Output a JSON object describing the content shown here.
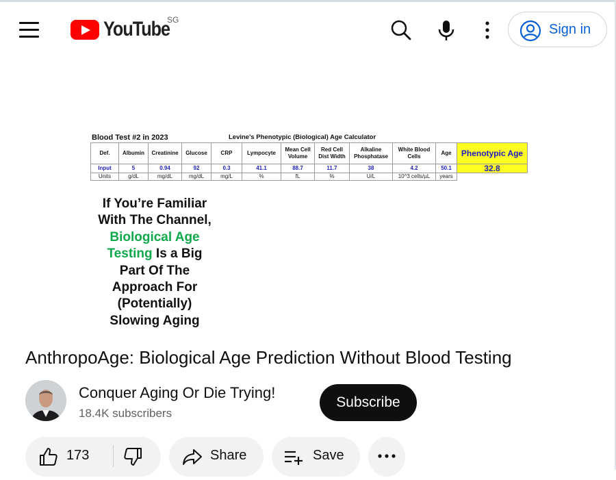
{
  "header": {
    "logo_text": "YouTube",
    "country_code": "SG",
    "sign_in_label": "Sign in",
    "icons": [
      "menu-icon",
      "search-icon",
      "mic-icon",
      "more-vert-icon",
      "account-circle-icon"
    ]
  },
  "thumbnail": {
    "blood_test_title": "Blood Test #2 in 2023",
    "calculator_title": "Levine's Phenotypic (Biological) Age Calculator",
    "headers": [
      "Def.",
      "Albumin",
      "Creatinine",
      "Glucose",
      "CRP",
      "Lympocyte",
      "Mean Cell Volume",
      "Red Cell Dist Width",
      "Alkaline Phosphatase",
      "White Blood Cells",
      "Age",
      "Phenotypic Age"
    ],
    "inputs": [
      "Input",
      "5",
      "0.94",
      "92",
      "0.3",
      "41.1",
      "88.7",
      "11.7",
      "38",
      "4.2",
      "50.1",
      "32.8"
    ],
    "units": [
      "Units",
      "g/dL",
      "mg/dL",
      "mg/dL",
      "mg/L",
      "%",
      "fL",
      "%",
      "U/L",
      "10^3 cells/µL",
      "years",
      ""
    ],
    "caption_lines": [
      "If You’re Familiar",
      "With The Channel,",
      "Biological Age",
      "Testing",
      "Is a Big",
      "Part Of The",
      "Approach For",
      "(Potentially)",
      "Slowing Aging"
    ]
  },
  "video": {
    "title": "AnthropoAge: Biological Age Prediction Without Blood Testing"
  },
  "channel": {
    "name": "Conquer Aging Or Die Trying!",
    "subscribers": "18.4K subscribers",
    "subscribe_label": "Subscribe"
  },
  "actions": {
    "like_count": "173",
    "share_label": "Share",
    "save_label": "Save"
  },
  "colors": {
    "brand_red": "#ff0000",
    "link_blue": "#065fd4",
    "highlight_green": "#10a84c",
    "phenotypic_yellow": "#ffff22"
  }
}
